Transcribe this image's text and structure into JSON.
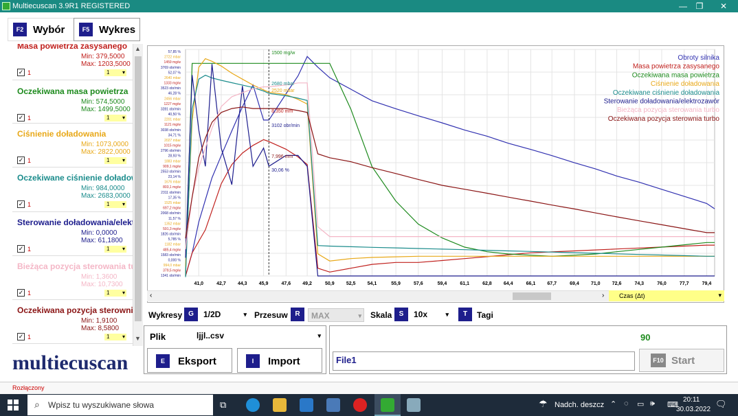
{
  "window": {
    "title": "Multiecuscan 3.9R1 REGISTERED",
    "min": "—",
    "max": "❐",
    "close": "✕"
  },
  "tabs": [
    {
      "key": "F2",
      "label": "Wybór"
    },
    {
      "key": "F5",
      "label": "Wykres"
    }
  ],
  "channels": [
    {
      "name": "Masa powietrza zasysanego",
      "min": "Min: 379,5000",
      "max": "Max: 1203,5000",
      "num": "1",
      "scale": "1",
      "color": "#c0201d"
    },
    {
      "name": "Oczekiwana masa powietrza",
      "min": "Min: 574,5000",
      "max": "Max: 1499,5000",
      "num": "1",
      "scale": "1",
      "color": "#1d8a1d"
    },
    {
      "name": "Ciśnienie doładowania",
      "min": "Min: 1073,0000",
      "max": "Max: 2822,0000",
      "num": "1",
      "scale": "1",
      "color": "#e8a818"
    },
    {
      "name": "Oczekiwane ciśnienie doładowania",
      "min": "Min: 984,0000",
      "max": "Max: 2683,0000",
      "num": "1",
      "scale": "1",
      "color": "#1b8c8c"
    },
    {
      "name": "Sterowanie doładowania/elektrozawór",
      "min": "Min: 0,0000",
      "max": "Max: 61,1800",
      "num": "1",
      "scale": "1",
      "color": "#1c1c8c"
    },
    {
      "name": "Bieżąca pozycja sterowania turbo",
      "min": "Min: 1,3600",
      "max": "Max: 10,7300",
      "num": "1",
      "scale": "1",
      "color": "#f4b6c6"
    },
    {
      "name": "Oczekiwana pozycja sterownia turbo",
      "min": "Min: 1,9100",
      "max": "Max: 8,5800",
      "num": "1",
      "scale": "1",
      "color": "#8a1414"
    }
  ],
  "chart_data": {
    "type": "line",
    "x": [
      40.0,
      40.5,
      41.0,
      41.5,
      42.0,
      42.7,
      43.5,
      44.3,
      45.1,
      45.9,
      46.3,
      47.6,
      48.5,
      49.2,
      50.0,
      50.9,
      52.5,
      54.1,
      55.9,
      57.6,
      59.4,
      61.1,
      62.8,
      64.4,
      66.1,
      67.7,
      69.4,
      71.0,
      72.6,
      74.3,
      76.0,
      77.7,
      79.4,
      80.0
    ],
    "xticks": [
      "41,0",
      "42,7",
      "44,3",
      "45,9",
      "47,6",
      "49,2",
      "50,9",
      "52,5",
      "54,1",
      "55,9",
      "57,6",
      "59,4",
      "61,1",
      "62,8",
      "64,4",
      "66,1",
      "67,7",
      "69,4",
      "71,0",
      "72,6",
      "74,3",
      "76,0",
      "77,7",
      "79,4"
    ],
    "xlabel": "Czas (Δt)",
    "series": [
      {
        "name": "Obroty silnika",
        "color": "#3030b0",
        "values": [
          1341,
          1600,
          1950,
          2200,
          2450,
          2700,
          2980,
          3250,
          3500,
          3102,
          3102,
          3400,
          3600,
          3820,
          3700,
          3580,
          3450,
          3320,
          3230,
          3150,
          3070,
          2990,
          2920,
          2840,
          2770,
          2700,
          2620,
          2550,
          2470,
          2400,
          2320,
          2240,
          2160,
          2100
        ]
      },
      {
        "name": "Masa powietrza zasysanego",
        "color": "#c0201d",
        "values": [
          379.5,
          500,
          560,
          620,
          720,
          860,
          960,
          1020,
          1060,
          1090,
          1080,
          1040,
          1000,
          960,
          420,
          400,
          420,
          440,
          450,
          450,
          460,
          470,
          480,
          490,
          500,
          505,
          510,
          515,
          520,
          525,
          530,
          535,
          540,
          540
        ]
      },
      {
        "name": "Oczekiwana masa powietrza",
        "color": "#1d8a1d",
        "values": [
          574.5,
          1499.5,
          1499.5,
          1499.5,
          1499.5,
          1499.5,
          1499.5,
          1499.5,
          1499.5,
          1499.5,
          1499.5,
          1499.5,
          1499.5,
          1499.5,
          1499.5,
          1499.5,
          1300,
          1050,
          900,
          800,
          740,
          700,
          680,
          670,
          665,
          660,
          665,
          670,
          680,
          690,
          700,
          710,
          720,
          720
        ]
      },
      {
        "name": "Ciśnienie doładowania",
        "color": "#e8a818",
        "values": [
          1073,
          2300,
          2750,
          2822,
          2800,
          2760,
          2700,
          2650,
          2600,
          2560,
          2540,
          2520,
          2480,
          2440,
          1180,
          1120,
          1140,
          1150,
          1155,
          1160,
          1160,
          1160,
          1160,
          1160,
          1160,
          1160,
          1160,
          1160,
          1160,
          1160,
          1160,
          1160,
          1160,
          1160
        ]
      },
      {
        "name": "Oczekiwane ciśnienie doładowania",
        "color": "#1b8c8c",
        "values": [
          984,
          2400,
          2650,
          2683,
          2660,
          2640,
          2620,
          2600,
          2580,
          2550,
          2530,
          2510,
          2490,
          2470,
          1250,
          1245,
          1240,
          1235,
          1230,
          1225,
          1220,
          1215,
          1210,
          1205,
          1200,
          1195,
          1190,
          1185,
          1180,
          1175,
          1170,
          1165,
          1160,
          1160
        ]
      },
      {
        "name": "Sterowanie doładowania/elektrozawór",
        "color": "#1c1c8c",
        "values": [
          5,
          55,
          40,
          30,
          58,
          35,
          25,
          52,
          30,
          35,
          30,
          33,
          33,
          30,
          0,
          0,
          0,
          0,
          0,
          0,
          0,
          0,
          0,
          0,
          0,
          0,
          0,
          0,
          0,
          0,
          0,
          0,
          0,
          0
        ]
      },
      {
        "name": "Bieżąca pozycja sterowania turbo",
        "color": "#f4b6c6",
        "values": [
          1.36,
          4,
          5.5,
          6.5,
          7.5,
          8.6,
          9.1,
          9.3,
          9.5,
          9.6,
          9.6,
          9.7,
          9.8,
          9.8,
          2.5,
          2,
          2,
          2,
          2,
          2,
          2,
          2,
          2,
          2,
          2,
          2,
          2,
          2,
          2,
          2,
          2,
          2,
          2,
          2
        ]
      },
      {
        "name": "Oczekiwana pozycja sterownia turbo",
        "color": "#8a1414",
        "values": [
          1.91,
          4,
          6,
          7,
          7.8,
          8.3,
          8.5,
          8.58,
          8.5,
          8.5,
          8.5,
          8.5,
          8.4,
          8.3,
          6.2,
          6.0,
          5.8,
          5.5,
          5.2,
          4.9,
          4.6,
          4.4,
          4.2,
          4.0,
          3.8,
          3.6,
          3.4,
          3.2,
          3.0,
          2.8,
          2.6,
          2.4,
          2.2,
          2.2
        ]
      }
    ],
    "annotations": [
      "1500 mg/w",
      "2680 mbar",
      "2520 mbar",
      "8,350 mm",
      "3102 obr/min",
      "7,996 mm",
      "30,06 %"
    ],
    "yticks_left": [
      "57,85 %",
      "2722 mbar",
      "1459 mg/w",
      "3769 obr/min",
      "52,07 %",
      "2640 mbar",
      "1333 mg/w",
      "3523 obr/min",
      "46,28 %",
      "2456 mbar",
      "1227 mg/w",
      "3281 obr/min",
      "40,50 %",
      "2201 mbar",
      "1121 mg/w",
      "3038 obr/min",
      "34,71 %",
      "2027 mbar",
      "1015 mg/w",
      "2796 obr/min",
      "28,93 %",
      "1883 mbar",
      "909,1 mg/w",
      "2553 obr/min",
      "23,14 %",
      "1676 mbar",
      "803,1 mg/w",
      "2311 obr/min",
      "17,35 %",
      "1525 mbar",
      "697,2 mg/w",
      "2068 obr/min",
      "11,57 %",
      "1352 mbar",
      "591,3 mg/w",
      "1826 obr/min",
      "5,785 %",
      "1182 mbar",
      "485,4 mg/w",
      "1583 obr/min",
      "0,000 %",
      "994,0 mbar",
      "379,5 mg/w",
      "1341 obr/min"
    ],
    "grid": true,
    "legend": "top-right"
  },
  "controls": {
    "wykresy_label": "Wykresy",
    "wykresy_key": "G",
    "wykresy_value": "1/2D",
    "przesuw_label": "Przesuw",
    "przesuw_key": "R",
    "przesuw_value": "MAX",
    "skala_label": "Skala",
    "skala_key": "S",
    "skala_value": "10x",
    "tagi_key": "T",
    "tagi_label": "Tagi"
  },
  "file": {
    "label": "Plik",
    "value": "ljjl..csv"
  },
  "export": {
    "key": "E",
    "label": "Eksport"
  },
  "import": {
    "key": "I",
    "label": "Import"
  },
  "session": {
    "counter": "90",
    "name": "File1",
    "start_key": "F10",
    "start_label": "Start"
  },
  "logo": "multiecuscan",
  "status": "Rozłączony",
  "taskbar": {
    "search_placeholder": "Wpisz tu wyszukiwane słowa",
    "weather": "Nadch. deszcz",
    "time": "20:11",
    "date": "30.03.2022"
  }
}
